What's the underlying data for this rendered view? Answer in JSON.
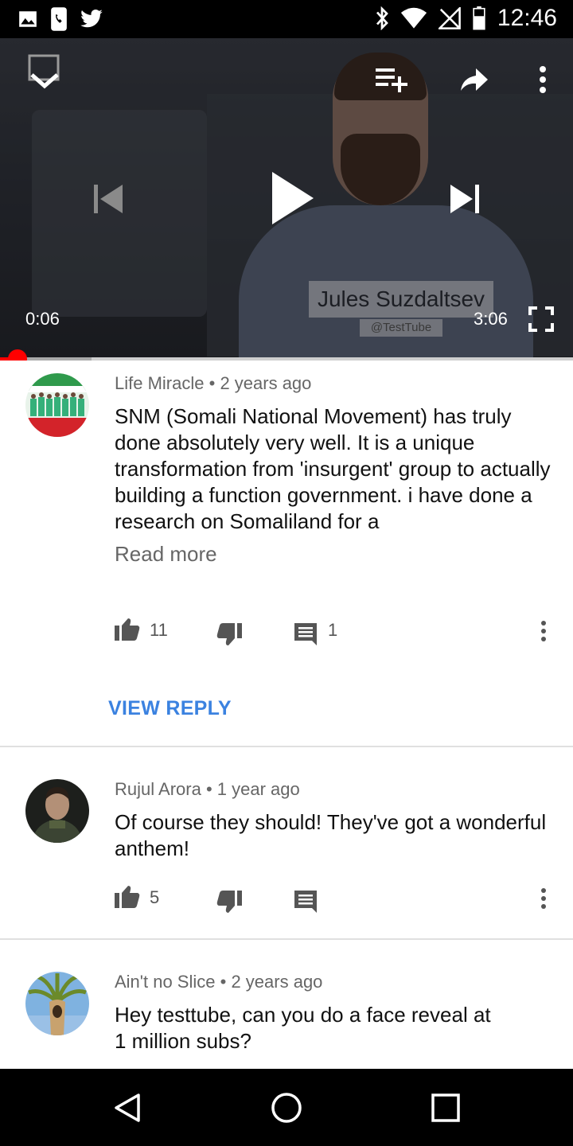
{
  "status_bar": {
    "time": "12:46",
    "left_icons": [
      "gallery-icon",
      "phone-icon",
      "twitter-icon"
    ],
    "right_icons": [
      "bluetooth-icon",
      "wifi-icon",
      "no-signal-icon",
      "battery-icon"
    ]
  },
  "player": {
    "overlay_name": "Jules Suzdaltsev",
    "overlay_handle": "@TestTube",
    "current_time": "0:06",
    "duration": "3:06",
    "progress_fraction": 0.03,
    "buffered_fraction": 0.16,
    "accent_color": "#ff0000",
    "icons": [
      "collapse-icon",
      "add-to-playlist-icon",
      "share-icon",
      "more-vert-icon",
      "previous-icon",
      "play-icon",
      "next-icon",
      "fullscreen-icon"
    ]
  },
  "comments": [
    {
      "author": "Life Miracle",
      "separator": "•",
      "age": "2 years ago",
      "text": "SNM (Somali National Movement) has truly done absolutely very well. It is a unique transformation from 'insurgent' group to actually building a function government. i have done a research on Somaliland for a",
      "read_more": "Read more",
      "likes": "11",
      "replies": "1",
      "view_reply": "VIEW REPLY"
    },
    {
      "author": "Rujul Arora",
      "separator": "•",
      "age": "1 year ago",
      "text": "Of course they should! They've got a wonderful anthem!",
      "likes": "5"
    },
    {
      "author": "Ain't no Slice",
      "separator": "•",
      "age": "2 years ago",
      "text": "Hey testtube, can you do a face reveal at 1 million subs?"
    }
  ],
  "nav_bar": {
    "icons": [
      "back-icon",
      "home-icon",
      "recents-icon"
    ]
  },
  "colors": {
    "link_blue": "#3b82e0",
    "progress_red": "#ff0000"
  }
}
